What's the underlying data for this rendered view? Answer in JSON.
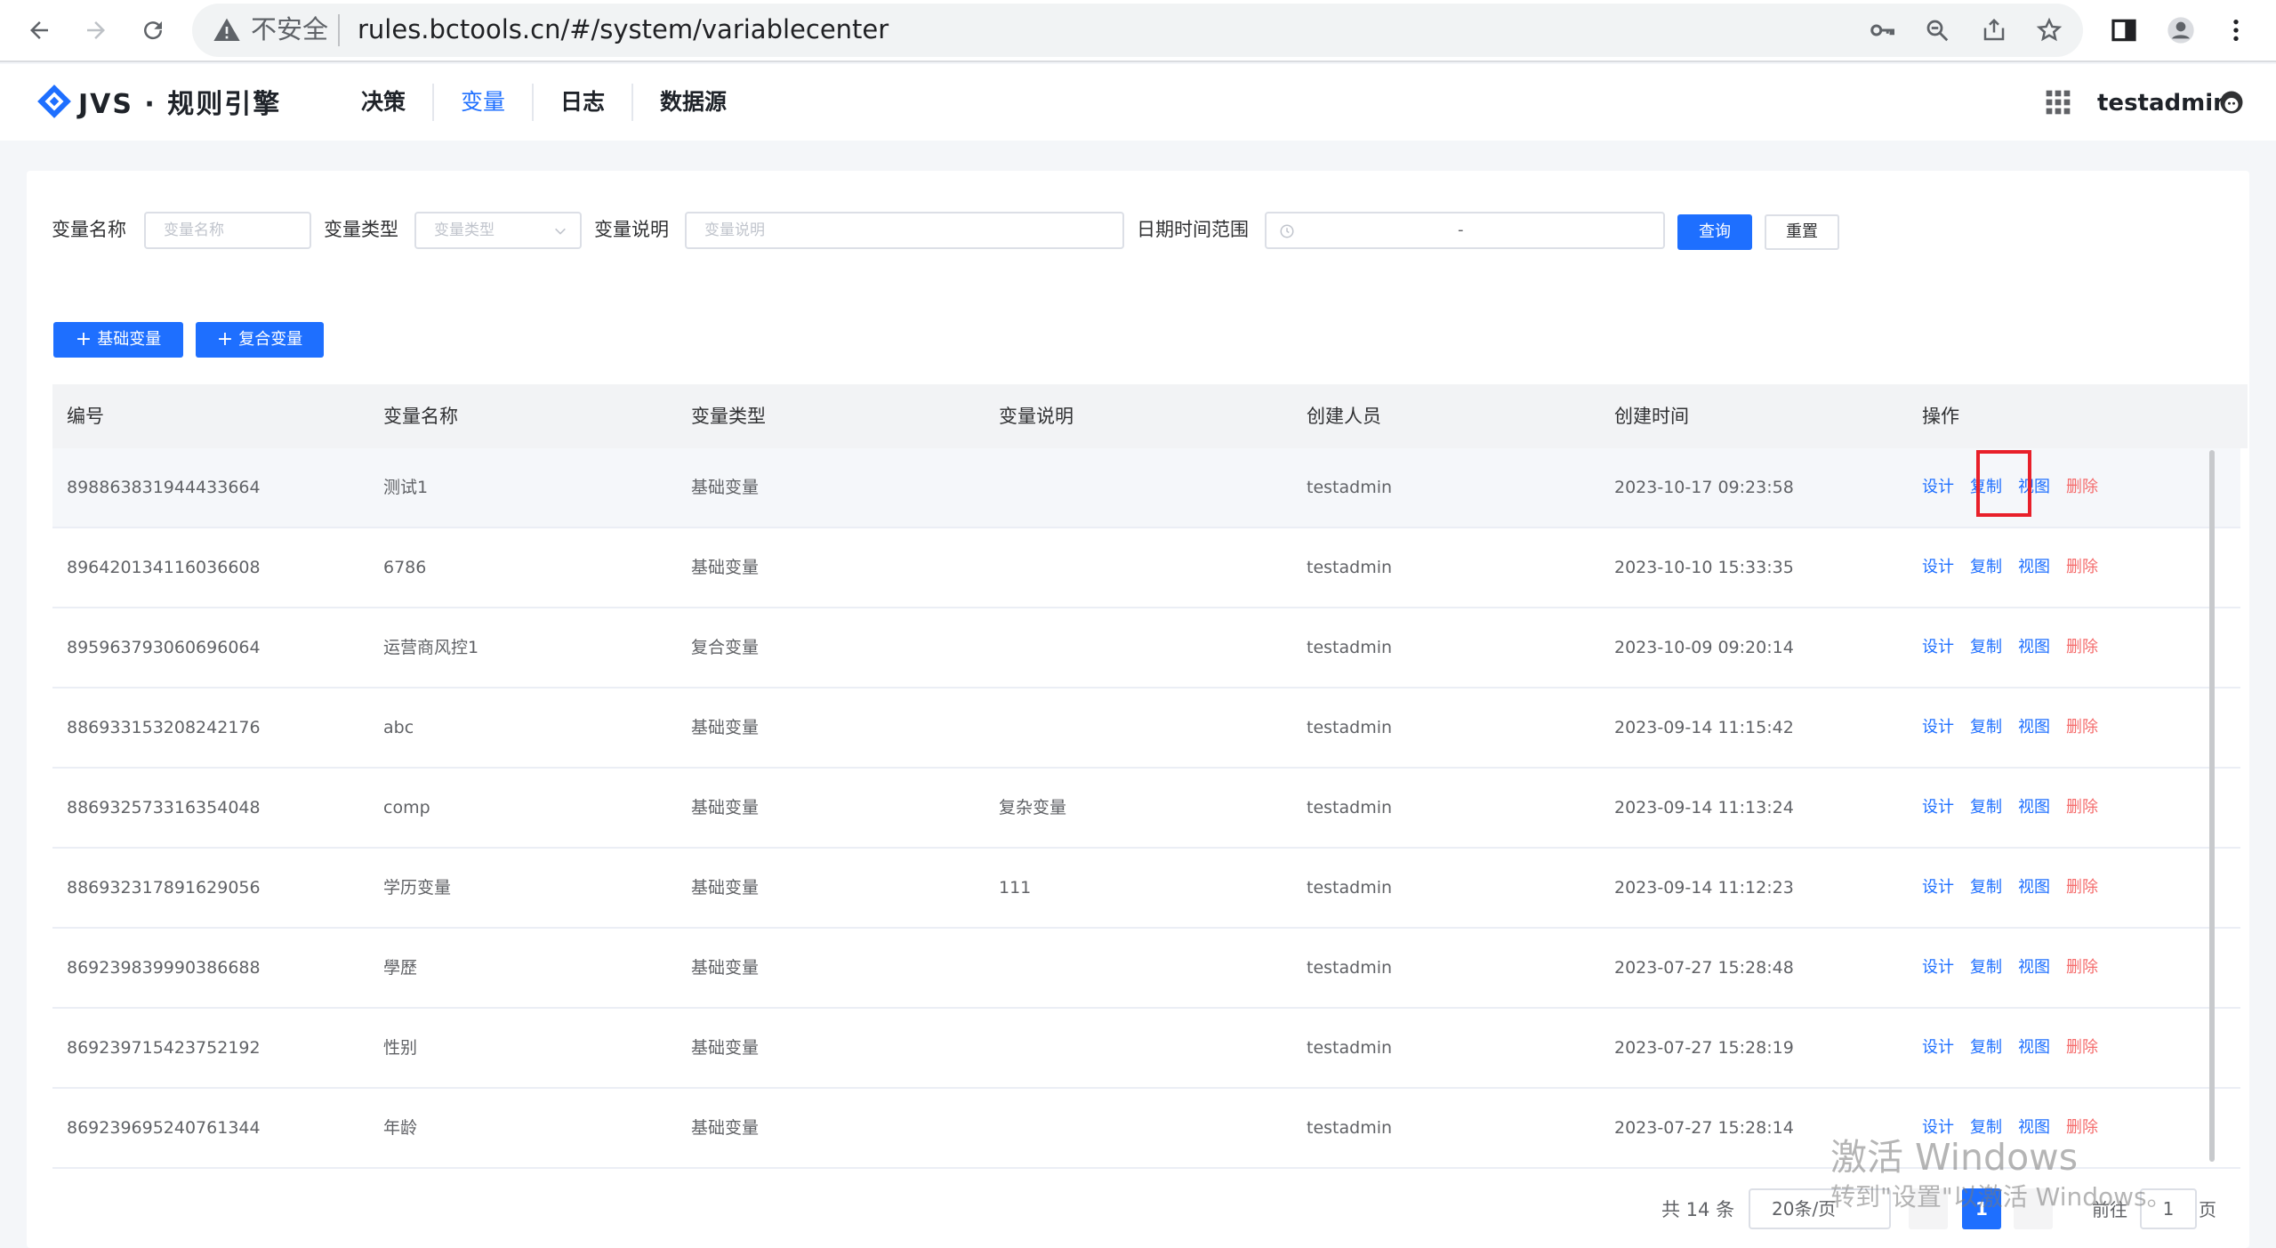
{
  "browser": {
    "insecure_label": "不安全",
    "url": "rules.bctools.cn/#/system/variablecenter"
  },
  "header": {
    "logo_text": "JVS · 规则引擎",
    "nav": [
      "决策",
      "变量",
      "日志",
      "数据源"
    ],
    "active_nav": "变量",
    "username": "testadmin"
  },
  "filters": {
    "name_label": "变量名称",
    "name_placeholder": "变量名称",
    "type_label": "变量类型",
    "type_placeholder": "变量类型",
    "desc_label": "变量说明",
    "desc_placeholder": "变量说明",
    "date_label": "日期时间范围",
    "date_separator": "-",
    "query_button": "查询",
    "reset_button": "重置"
  },
  "actions": {
    "add_basic": "基础变量",
    "add_composite": "复合变量"
  },
  "table": {
    "columns": [
      "编号",
      "变量名称",
      "变量类型",
      "变量说明",
      "创建人员",
      "创建时间",
      "操作"
    ],
    "op_labels": [
      "设计",
      "复制",
      "视图",
      "删除"
    ],
    "rows": [
      {
        "id": "898863831944433664",
        "name": "测试1",
        "type": "基础变量",
        "desc": "",
        "creator": "testadmin",
        "created": "2023-10-17 09:23:58"
      },
      {
        "id": "896420134116036608",
        "name": "6786",
        "type": "基础变量",
        "desc": "",
        "creator": "testadmin",
        "created": "2023-10-10 15:33:35"
      },
      {
        "id": "895963793060696064",
        "name": "运营商风控1",
        "type": "复合变量",
        "desc": "",
        "creator": "testadmin",
        "created": "2023-10-09 09:20:14"
      },
      {
        "id": "886933153208242176",
        "name": "abc",
        "type": "基础变量",
        "desc": "",
        "creator": "testadmin",
        "created": "2023-09-14 11:15:42"
      },
      {
        "id": "886932573316354048",
        "name": "comp",
        "type": "基础变量",
        "desc": "复杂变量",
        "creator": "testadmin",
        "created": "2023-09-14 11:13:24"
      },
      {
        "id": "886932317891629056",
        "name": "学历变量",
        "type": "基础变量",
        "desc": "111",
        "creator": "testadmin",
        "created": "2023-09-14 11:12:23"
      },
      {
        "id": "869239839990386688",
        "name": "學歷",
        "type": "基础变量",
        "desc": "",
        "creator": "testadmin",
        "created": "2023-07-27 15:28:48"
      },
      {
        "id": "869239715423752192",
        "name": "性别",
        "type": "基础变量",
        "desc": "",
        "creator": "testadmin",
        "created": "2023-07-27 15:28:19"
      },
      {
        "id": "869239695240761344",
        "name": "年龄",
        "type": "基础变量",
        "desc": "",
        "creator": "testadmin",
        "created": "2023-07-27 15:28:14"
      }
    ]
  },
  "pagination": {
    "total": "共 14 条",
    "page_size": "20条/页",
    "current_page": "1",
    "goto_label": "前往",
    "goto_value": "1",
    "page_suffix": "页"
  },
  "watermark": {
    "line1": "激活 Windows",
    "line2": "转到\"设置\"以激活 Windows。"
  },
  "colors": {
    "primary": "#1e6fff",
    "danger": "#f56c6c",
    "highlight_box": "#e8202a"
  }
}
